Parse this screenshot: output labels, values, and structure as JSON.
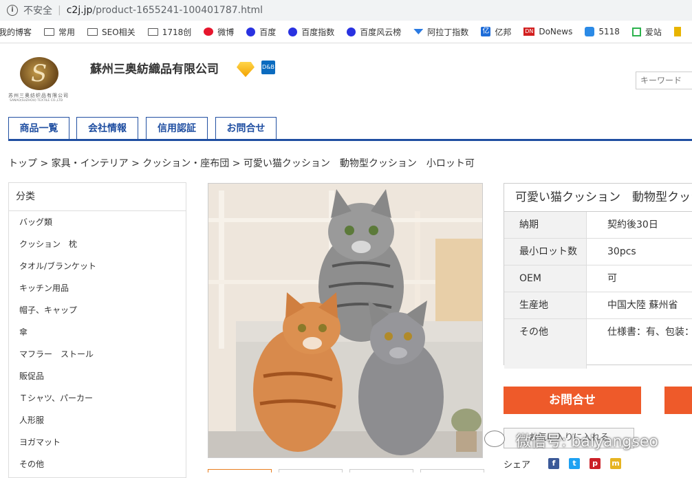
{
  "browser": {
    "insecure_label": "不安全",
    "url_host": "c2j.jp",
    "url_path": "/product-1655241-100401787.html",
    "bookmarks": [
      {
        "label": "我的博客",
        "icon": "none"
      },
      {
        "label": "常用",
        "icon": "folder-icon"
      },
      {
        "label": "SEO相关",
        "icon": "folder-icon"
      },
      {
        "label": "1718创",
        "icon": "folder-icon"
      },
      {
        "label": "微博",
        "icon": "weibo-icon"
      },
      {
        "label": "百度",
        "icon": "baidu-paw-icon"
      },
      {
        "label": "百度指数",
        "icon": "baidu-paw-icon"
      },
      {
        "label": "百度风云榜",
        "icon": "baidu-paw-icon"
      },
      {
        "label": "阿拉丁指数",
        "icon": "aladdin-icon"
      },
      {
        "label": "亿邦",
        "icon": "yibang-icon"
      },
      {
        "label": "DoNews",
        "icon": "donews-icon"
      },
      {
        "label": "5118",
        "icon": "5118-icon"
      },
      {
        "label": "爱站",
        "icon": "aizhan-icon"
      }
    ]
  },
  "header": {
    "logo_cn": "苏州三奥纺织品有限公司",
    "logo_en": "SANAO(SUZHOU) TEXTILE CO.,LTD",
    "company_name": "蘇州三奥紡織品有限公司",
    "dnb_label": "D&B",
    "keyword_placeholder": "キーワード"
  },
  "nav": {
    "tabs": [
      "商品一覧",
      "会社情報",
      "信用認証",
      "お問合せ"
    ]
  },
  "breadcrumb": {
    "text": "トップ > 家具・インテリア > クッション・座布団 > 可愛い猫クッション　動物型クッション　小ロット可"
  },
  "sidebar": {
    "title": "分类",
    "items": [
      "バッグ類",
      "クッション　枕",
      "タオル/ブランケット",
      "キッチン用品",
      "帽子、キャップ",
      "傘",
      "マフラー　ストール",
      "販促品",
      "Ｔシャツ、パーカー",
      "人形服",
      "ヨガマット",
      "その他"
    ]
  },
  "product": {
    "title": "可愛い猫クッション　動物型クッション",
    "specs": [
      {
        "key": "納期",
        "value": "契約後30日"
      },
      {
        "key": "最小ロット数",
        "value": "30pcs"
      },
      {
        "key": "OEM",
        "value": "可"
      },
      {
        "key": "生産地",
        "value": "中国大陸 蘇州省"
      },
      {
        "key": "その他",
        "value": "仕様書：有、包装："
      }
    ],
    "contact_label": "お問合せ",
    "favorite_label": "お気に入りに入れる",
    "share_label": "シェア"
  },
  "watermark": "微信号: baiyangseo",
  "colors": {
    "brand_blue": "#1f4ea1",
    "contact_orange": "#ee5a2a"
  }
}
